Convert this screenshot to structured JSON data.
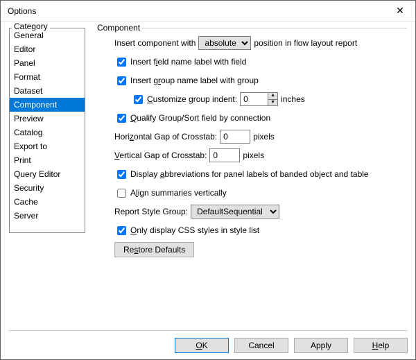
{
  "window": {
    "title": "Options"
  },
  "category": {
    "label": "Category",
    "items": [
      "General",
      "Editor",
      "Panel",
      "Format",
      "Dataset",
      "Component",
      "Preview",
      "Catalog",
      "Export to",
      "Print",
      "Query Editor",
      "Security",
      "Cache",
      "Server"
    ],
    "selected": "Component"
  },
  "component": {
    "group_label": "Component",
    "insert_prefix": "Insert component with",
    "insert_position_value": "absolute",
    "insert_suffix": "position in flow layout report",
    "field_label_cb": {
      "checked": true,
      "label_html": "Insert f<u>i</u>eld name label with field"
    },
    "group_label_cb": {
      "checked": true,
      "label_html": "Insert g<u>r</u>oup name label with group"
    },
    "customize_indent_cb": {
      "checked": true,
      "label_html": "<u>C</u>ustomize group indent:"
    },
    "indent_value": "0",
    "indent_unit": "inches",
    "qualify_cb": {
      "checked": true,
      "label_html": "<u>Q</u>ualify Group/Sort field by connection"
    },
    "hgap_label_html": "Hori<u>z</u>ontal Gap of Crosstab:",
    "hgap_value": "0",
    "vgap_label_html": "<u>V</u>ertical Gap of Crosstab:",
    "vgap_value": "0",
    "pixels": "pixels",
    "abbrev_cb": {
      "checked": true,
      "label_html": "Display <u>a</u>bbreviations for panel labels of banded object and table"
    },
    "align_cb": {
      "checked": false,
      "label_html": "A<u>l</u>ign summaries vertically"
    },
    "style_group_label": "Report Style Group:",
    "style_group_value": "DefaultSequential",
    "only_css_cb": {
      "checked": true,
      "label_html": "<u>O</u>nly display CSS styles in style list"
    },
    "restore_label_html": "Re<u>s</u>tore Defaults"
  },
  "buttons": {
    "ok_html": "<u>O</u>K",
    "cancel": "Cancel",
    "apply": "Apply",
    "help_html": "<u>H</u>elp"
  }
}
